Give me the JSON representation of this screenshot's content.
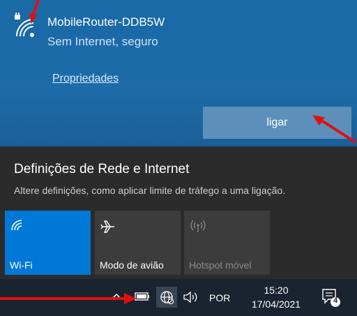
{
  "network": {
    "name": "MobileRouter-DDB5W",
    "status": "Sem Internet, seguro",
    "properties_link": "Propriedades",
    "connect_button": "ligar"
  },
  "settings": {
    "title": "Definições de Rede e Internet",
    "description": "Altere definições, como aplicar limite de tráfego a uma ligação."
  },
  "tiles": [
    {
      "label": "Wi-Fi",
      "icon": "wifi-icon",
      "state": "on"
    },
    {
      "label": "Modo de avião",
      "icon": "airplane-icon",
      "state": "off"
    },
    {
      "label": "Hotspot móvel",
      "icon": "hotspot-icon",
      "state": "disabled"
    }
  ],
  "taskbar": {
    "language": "POR",
    "time": "15:20",
    "date": "17/04/2021",
    "notification_count": "4"
  },
  "colors": {
    "accent": "#0078d7",
    "panel_top": "#1d6ba9",
    "panel_bottom": "#2b2b2b",
    "annotation_arrow": "#e01010"
  }
}
